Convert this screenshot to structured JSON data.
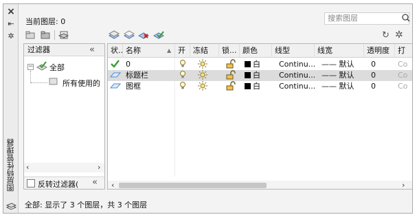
{
  "side": {
    "close_icon": "×",
    "pin_icon": "⇤",
    "settings_icon": "✲",
    "vertical_title": "图层特性管理器",
    "bottom_icon": "layers-icon"
  },
  "top": {
    "current_layer": "当前图层: 0",
    "search_placeholder": "搜索图层"
  },
  "filters": {
    "header": "过滤器",
    "collapse": "«",
    "tree": {
      "root": "全部",
      "child": "所有使用的"
    },
    "invert_label": "反转过滤器(",
    "invert_collapse": "«"
  },
  "grid": {
    "headers": [
      "状...",
      "名称",
      "开",
      "冻结",
      "锁...",
      "颜色",
      "线型",
      "线宽",
      "透明度",
      "打"
    ],
    "rows": [
      {
        "status_icon": "check",
        "name": "0",
        "color": "白",
        "linetype": "Continu...",
        "lineweight": "—— 默认",
        "transparency": "0",
        "plot": "Co"
      },
      {
        "status_icon": "layer",
        "name": "标题栏",
        "color": "白",
        "linetype": "Continu...",
        "lineweight": "—— 默认",
        "transparency": "0",
        "plot": "Co",
        "selected": true
      },
      {
        "status_icon": "layer",
        "name": "图框",
        "color": "白",
        "linetype": "Continu...",
        "lineweight": "—— 默认",
        "transparency": "0",
        "plot": "Co"
      }
    ]
  },
  "status_text": "全部: 显示了 3 个图层，共 3 个图层",
  "colors": {
    "accent": "#4a90d9",
    "check": "#3a9a35",
    "bulb": "#e9c44a",
    "selected_row": "#dcdcdc"
  }
}
